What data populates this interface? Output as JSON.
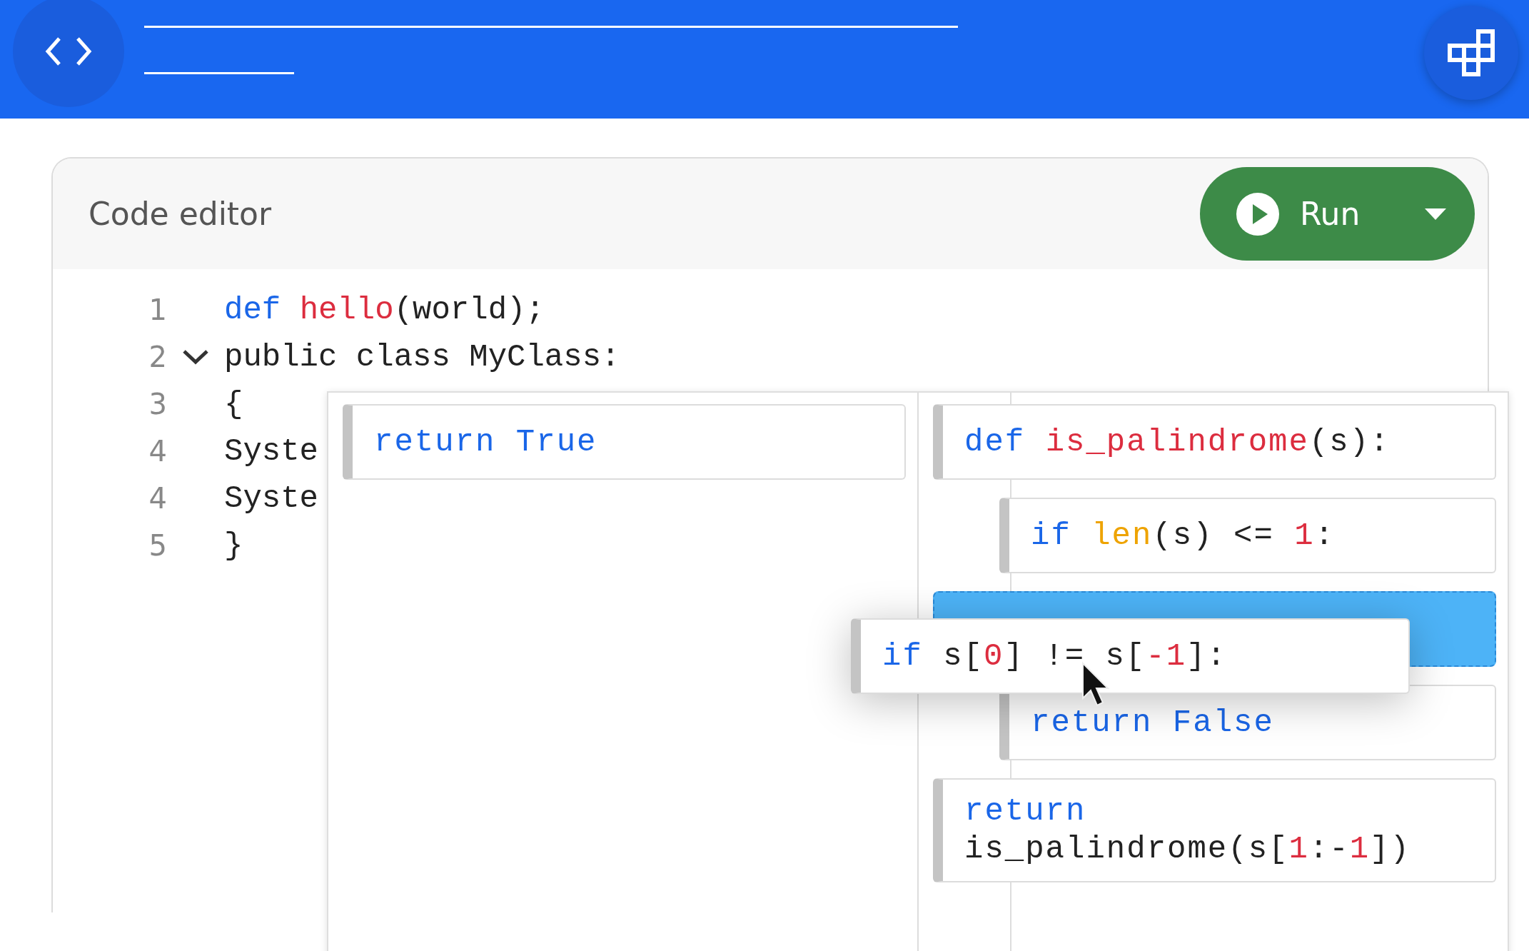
{
  "editor": {
    "title": "Code editor",
    "run_button": {
      "label": "Run"
    },
    "lines": [
      {
        "number": "1",
        "tokens": [
          {
            "t": "def ",
            "kind": "keyword"
          },
          {
            "t": "hello",
            "kind": "function"
          },
          {
            "t": "(world);",
            "kind": "plain"
          }
        ]
      },
      {
        "number": "2",
        "expanded": true,
        "tokens": [
          {
            "t": "public class MyClass:",
            "kind": "plain"
          }
        ]
      },
      {
        "number": "3",
        "tokens": [
          {
            "t": "{",
            "kind": "plain"
          }
        ]
      },
      {
        "number": "4",
        "tokens": [
          {
            "t": "Syste",
            "kind": "plain"
          }
        ]
      },
      {
        "number": "4",
        "tokens": [
          {
            "t": "Syste",
            "kind": "plain"
          }
        ]
      },
      {
        "number": "5",
        "tokens": [
          {
            "t": "}",
            "kind": "plain"
          }
        ]
      }
    ]
  },
  "block_palette": {
    "source_blocks": [
      {
        "tokens": [
          {
            "t": "return True",
            "kind": "keyword"
          }
        ]
      }
    ],
    "program_blocks": [
      {
        "kind": "code",
        "tokens": [
          {
            "t": "def ",
            "kind": "keyword"
          },
          {
            "t": "is_palindrome",
            "kind": "function"
          },
          {
            "t": "(s):",
            "kind": "plain"
          }
        ],
        "children": [
          {
            "kind": "code",
            "tokens": [
              {
                "t": "if ",
                "kind": "keyword"
              },
              {
                "t": "len",
                "kind": "builtin"
              },
              {
                "t": "(s) <= ",
                "kind": "plain"
              },
              {
                "t": "1",
                "kind": "number"
              },
              {
                "t": ":",
                "kind": "plain"
              }
            ]
          }
        ]
      },
      {
        "kind": "drop-target",
        "children": [
          {
            "kind": "code",
            "tokens": [
              {
                "t": "return False",
                "kind": "keyword"
              }
            ]
          }
        ]
      },
      {
        "kind": "code",
        "tokens": [
          {
            "t": "return",
            "kind": "keyword"
          },
          {
            "t": " is_palindrome(s[",
            "kind": "plain"
          },
          {
            "t": "1",
            "kind": "number"
          },
          {
            "t": ":-",
            "kind": "plain"
          },
          {
            "t": "1",
            "kind": "number"
          },
          {
            "t": "])",
            "kind": "plain"
          }
        ]
      }
    ],
    "dragged_block": {
      "tokens": [
        {
          "t": "if ",
          "kind": "keyword"
        },
        {
          "t": "s[",
          "kind": "plain"
        },
        {
          "t": "0",
          "kind": "number"
        },
        {
          "t": "] != s[",
          "kind": "plain"
        },
        {
          "t": "-1",
          "kind": "number"
        },
        {
          "t": "]:",
          "kind": "plain"
        }
      ]
    }
  }
}
